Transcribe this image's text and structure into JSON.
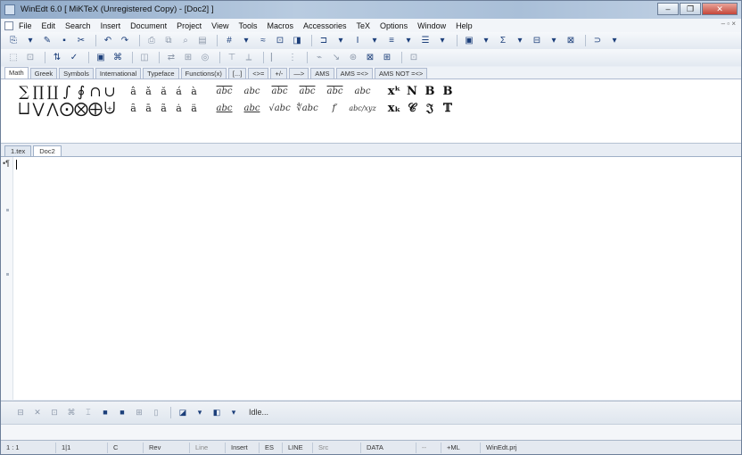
{
  "window": {
    "title": "WinEdt 6.0 [ MiKTeX (Unregistered Copy) - [Doc2] ]",
    "buttons": [
      "–",
      "❐",
      "✕"
    ]
  },
  "menubar": {
    "items": [
      "File",
      "Edit",
      "Search",
      "Insert",
      "Document",
      "Project",
      "View",
      "Tools",
      "Macros",
      "Accessories",
      "TeX",
      "Options",
      "Window",
      "Help"
    ],
    "right": "– ▫ ×"
  },
  "toolbar1": {
    "buttons": [
      "⎘",
      "▾",
      "✎",
      "▪",
      "✂",
      "↶",
      "↷",
      "⎙",
      "⧉",
      "⌕",
      "▤",
      "#",
      "▾",
      "≈",
      "⊡",
      "◨",
      "⊐",
      "▾",
      "I",
      "▾",
      "≡",
      "▾",
      "☰",
      "▾",
      "▣",
      "▾",
      "Σ",
      "▾",
      "⊟",
      "▾",
      "⊠",
      "⊃",
      "▾"
    ]
  },
  "toolbar2": {
    "buttons": [
      "⬚",
      "⊡",
      "⇅",
      "✓",
      "▣",
      "⌘",
      "◫",
      "⇄",
      "⊞",
      "◎",
      "⊤",
      "⟂",
      "⎸",
      "⋮",
      "⌁",
      "↘",
      "⊛",
      "⊠",
      "⊞",
      "⊡"
    ]
  },
  "palette_tabs": [
    "Math",
    "Greek",
    "Symbols",
    "International",
    "Typeface",
    "Functions(x)",
    "[...]",
    "<>=",
    "+/-",
    "—>",
    "AMS",
    "AMS =<>",
    "AMS NOT =<>"
  ],
  "palette": {
    "row1_big": [
      "∑",
      "∏",
      "∐",
      "∫",
      "∮",
      "∩",
      "∪"
    ],
    "row2_big": [
      "⨆",
      "⋁",
      "⋀",
      "⨀",
      "⨂",
      "⨁",
      "⨄"
    ],
    "row1_accents": [
      "â",
      "ǎ",
      "ă",
      "á",
      "à"
    ],
    "row2_accents": [
      "ȃ",
      "ā",
      "ã",
      "ȧ",
      "ä"
    ],
    "row1_deco": [
      "abc",
      "abc",
      "abc",
      "abc",
      "abc",
      "abc"
    ],
    "row2_deco": [
      "abc",
      "abc",
      "√abc",
      "∜abc",
      "f′",
      "abc/xyz"
    ],
    "row1_bold": [
      "xᵏ",
      "𝐍",
      "𝐁",
      "B"
    ],
    "row2_bold": [
      "xₖ",
      "𝒞",
      "𝔍",
      "𝕋"
    ]
  },
  "doc_tabs": [
    "1.tex",
    "Doc2"
  ],
  "editor": {
    "line_marker": "•¶"
  },
  "bottom_toolbar": {
    "buttons": [
      "⊟",
      "✕",
      "⊡",
      "⌘",
      "⌶",
      "■",
      "■",
      "⊞",
      "▯",
      "◪",
      "▾",
      "◧",
      "▾",
      "Idle..."
    ]
  },
  "statusbar": {
    "items": [
      "1 : 1",
      "1|1",
      "C",
      "Rev",
      "Line",
      "Insert",
      "ES",
      "LINE",
      "Src",
      "DATA",
      "--",
      "+ML",
      "WinEdt.prj"
    ]
  }
}
